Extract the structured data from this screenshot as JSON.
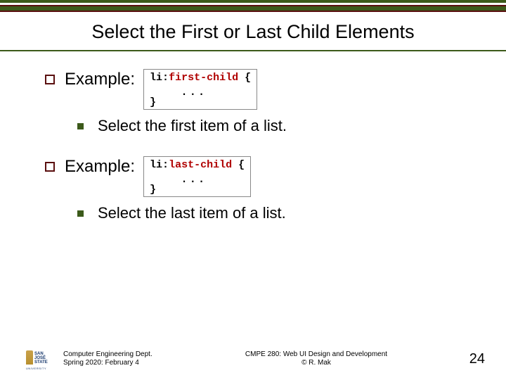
{
  "title": "Select the First or Last Child Elements",
  "example1": {
    "label": "Example:",
    "code_pre": "li:",
    "code_pseudo": "first-child",
    "code_post": " {",
    "code_ellipsis": ". . .",
    "code_close": "}",
    "desc": "Select the first item of a list."
  },
  "example2": {
    "label": "Example:",
    "code_pre": "li:",
    "code_pseudo": "last-child",
    "code_post": " {",
    "code_ellipsis": ". . .",
    "code_close": "}",
    "desc": "Select the last item of a list."
  },
  "footer": {
    "dept_line1": "Computer Engineering Dept.",
    "dept_line2": "Spring 2020: February 4",
    "center_line1": "CMPE 280: Web UI Design and Development",
    "center_line2": "© R. Mak",
    "page": "24"
  },
  "logo": {
    "line1": "SAN JOSÉ STATE",
    "sub": "UNIVERSITY"
  }
}
